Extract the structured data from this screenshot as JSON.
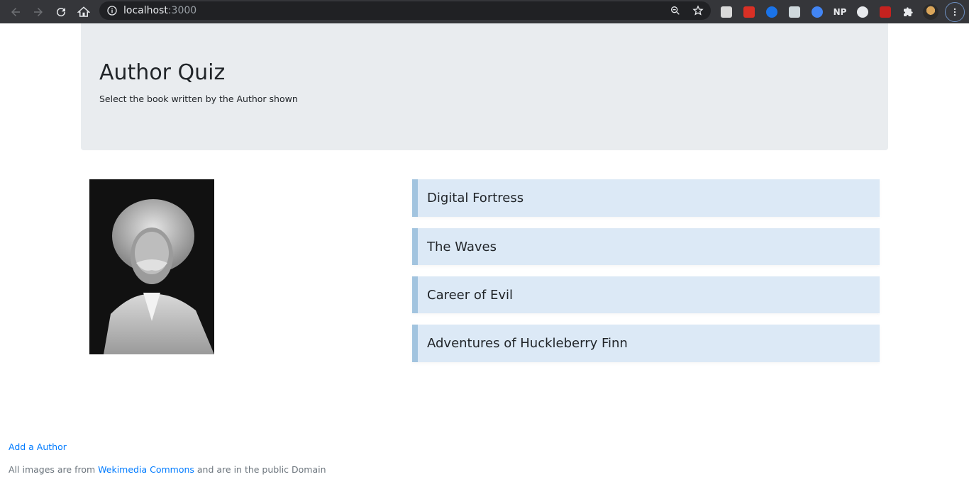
{
  "browser": {
    "url_host": "localhost",
    "url_port": ":3000",
    "extensions": [
      "cube-extension-icon",
      "red-play-extension-icon",
      "blue-c-extension-icon",
      "window-extension-icon",
      "glasses-extension-icon",
      "np-extension-icon",
      "block-extension-icon",
      "red-puzzle-extension-icon"
    ],
    "np_label": "NP"
  },
  "header": {
    "title": "Author Quiz",
    "subtitle": "Select the book written by the Author shown"
  },
  "answers": [
    {
      "title": "Digital Fortress"
    },
    {
      "title": "The Waves"
    },
    {
      "title": "Career of Evil"
    },
    {
      "title": "Adventures of Huckleberry Finn"
    }
  ],
  "footer": {
    "add_author": "Add a Author",
    "note_prefix": "All images are from",
    "note_link": "Wekimedia Commons",
    "note_suffix": "and are in the public Domain"
  },
  "colors": {
    "jumbotron_bg": "#e9ecef",
    "answer_bg": "#dce9f6",
    "answer_border": "#a2c4df",
    "link": "#007bff"
  }
}
